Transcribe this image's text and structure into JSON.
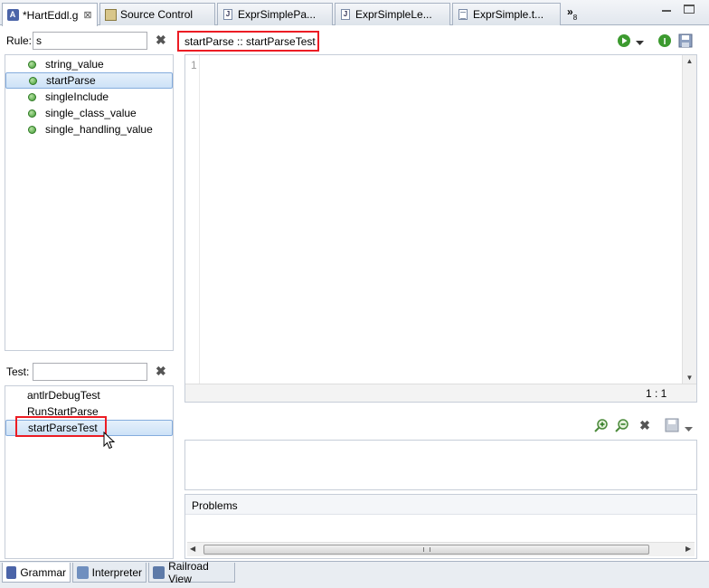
{
  "tabs": [
    {
      "label": "*HartEddl.g",
      "close": "⊠",
      "icon": "antlr-grammar-icon"
    },
    {
      "label": "Source Control",
      "icon": "source-control-icon"
    },
    {
      "label": "ExprSimplePa...",
      "icon": "java-file-icon"
    },
    {
      "label": "ExprSimpleLe...",
      "icon": "java-file-icon"
    },
    {
      "label": "ExprSimple.t...",
      "icon": "text-file-icon"
    }
  ],
  "overflow": {
    "chevron": "»",
    "count": "8"
  },
  "rule": {
    "label": "Rule:",
    "filter_value": "s",
    "items": [
      "string_value",
      "startParse",
      "singleInclude",
      "single_class_value",
      "single_handling_value"
    ],
    "selected_index": 1
  },
  "test": {
    "label": "Test:",
    "filter_value": "",
    "items": [
      "antlrDebugTest",
      "RunStartParse",
      "startParseTest"
    ],
    "selected_index": 2
  },
  "header": {
    "title": "startParse :: startParseTest"
  },
  "editor": {
    "line_number": "1",
    "cursor_position": "1 : 1"
  },
  "problems": {
    "title": "Problems"
  },
  "bottom_tabs": [
    "Grammar",
    "Interpreter",
    "Railroad View"
  ],
  "colors": {
    "highlight": "#ec1c24",
    "selection": "#cde2f7",
    "accent": "#4b64a8"
  }
}
